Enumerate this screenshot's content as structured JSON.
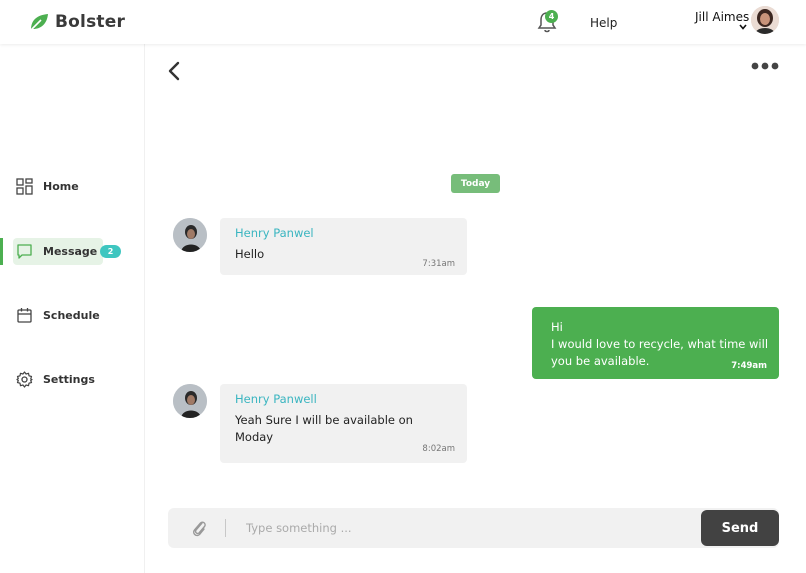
{
  "brand": {
    "name": "Bolster",
    "color": "#4caf50"
  },
  "header": {
    "notification_count": "4",
    "help_label": "Help",
    "user_name": "Jill Aimes"
  },
  "sidebar": {
    "items": [
      {
        "label": "Home",
        "icon": "grid-icon"
      },
      {
        "label": "Message",
        "icon": "chat-icon",
        "badge": "2",
        "active": true
      },
      {
        "label": "Schedule",
        "icon": "calendar-icon"
      },
      {
        "label": "Settings",
        "icon": "gear-icon"
      }
    ]
  },
  "chat": {
    "date_chip": "Today",
    "messages": [
      {
        "direction": "incoming",
        "sender": "Henry Panwel",
        "lines": [
          "Hello"
        ],
        "time": "7:31am"
      },
      {
        "direction": "outgoing",
        "lines": [
          "Hi",
          "I would love to recycle, what time will",
          "you be available."
        ],
        "time": "7:49am"
      },
      {
        "direction": "incoming",
        "sender": "Henry Panwell",
        "lines": [
          "Yeah Sure I will be available on",
          "Moday"
        ],
        "time": "8:02am"
      }
    ]
  },
  "composer": {
    "placeholder": "Type something ...",
    "value": "",
    "send_label": "Send"
  },
  "colors": {
    "accent_green": "#4caf50",
    "sender_teal": "#3ab5c0",
    "badge_teal": "#3ec6c0",
    "send_button": "#424242"
  }
}
